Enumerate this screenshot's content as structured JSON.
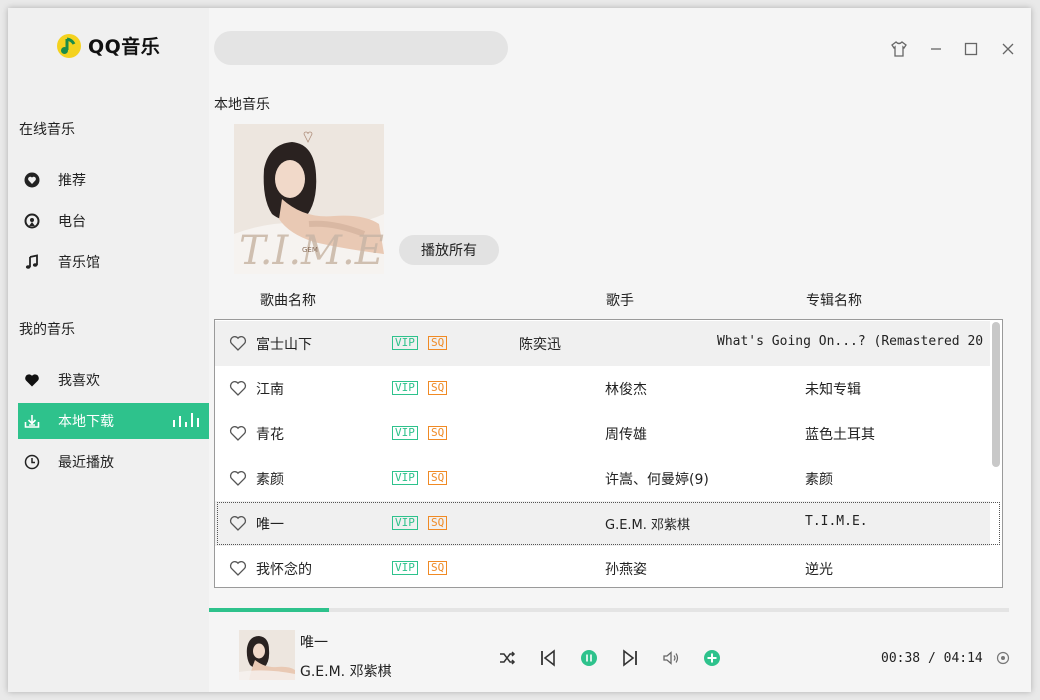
{
  "app": {
    "name": "QQ音乐",
    "brand_color": "#2ec28c",
    "logo_color": "#f4d21f"
  },
  "sidebar": {
    "sections": [
      {
        "title": "在线音乐",
        "items": [
          {
            "label": "推荐",
            "icon": "heart-circle-icon"
          },
          {
            "label": "电台",
            "icon": "radio-icon"
          },
          {
            "label": "音乐馆",
            "icon": "music-note-icon"
          }
        ]
      },
      {
        "title": "我的音乐",
        "items": [
          {
            "label": "我喜欢",
            "icon": "heart-icon"
          },
          {
            "label": "本地下载",
            "icon": "download-icon",
            "active": true
          },
          {
            "label": "最近播放",
            "icon": "clock-icon"
          }
        ]
      }
    ]
  },
  "search": {
    "value": "",
    "placeholder": ""
  },
  "page": {
    "title": "本地音乐",
    "play_all_label": "播放所有"
  },
  "columns": {
    "song": "歌曲名称",
    "artist": "歌手",
    "album": "专辑名称"
  },
  "songs": [
    {
      "title": "富士山下",
      "vip": "VIP",
      "sq": "SQ",
      "artist": "陈奕迅",
      "album": "What's Going On...? (Remastered 20"
    },
    {
      "title": "江南",
      "vip": "VIP",
      "sq": "SQ",
      "artist": "林俊杰",
      "album": "未知专辑"
    },
    {
      "title": "青花",
      "vip": "VIP",
      "sq": "SQ",
      "artist": "周传雄",
      "album": "蓝色土耳其"
    },
    {
      "title": "素颜",
      "vip": "VIP",
      "sq": "SQ",
      "artist": "许嵩、何曼婷(9)",
      "album": "素颜"
    },
    {
      "title": "唯一",
      "vip": "VIP",
      "sq": "SQ",
      "artist": "G.E.M. 邓紫棋",
      "album": "T.I.M.E."
    },
    {
      "title": "我怀念的",
      "vip": "VIP",
      "sq": "SQ",
      "artist": "孙燕姿",
      "album": "逆光"
    }
  ],
  "now_playing": {
    "title": "唯一",
    "artist": "G.E.M. 邓紫棋",
    "current_time": "00:38",
    "total_time": "04:14",
    "time_display": "00:38 / 04:14",
    "progress_fraction": 0.15
  },
  "album_art": {
    "text": "T.I.M.E",
    "small_text": "GEM"
  }
}
